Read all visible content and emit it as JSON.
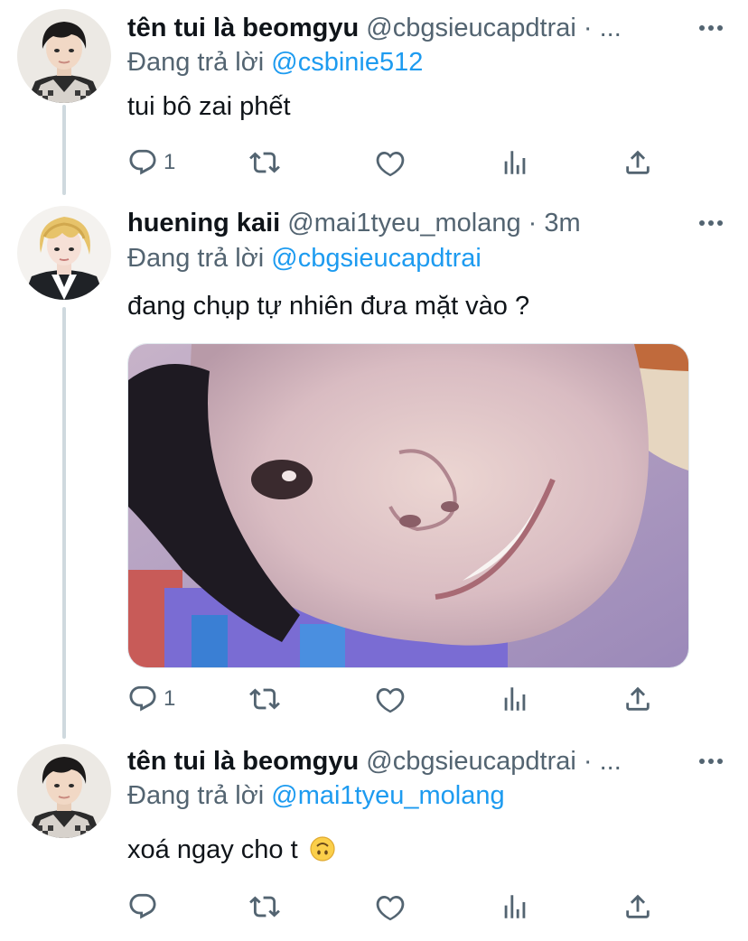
{
  "tweets": [
    {
      "display_name": "tên tui là beomgyu",
      "handle": "@cbgsieucapdtrai",
      "separator": "·",
      "time": "...",
      "replying_prefix": "Đang trả lời",
      "replying_to": "@csbinie512",
      "text": "tui bô zai phết",
      "reply_count": "1",
      "retweet_count": "",
      "like_count": ""
    },
    {
      "display_name": "huening kaii",
      "handle": "@mai1tyeu_molang",
      "separator": "·",
      "time": "3m",
      "replying_prefix": "Đang trả lời",
      "replying_to": "@cbgsieucapdtrai",
      "text": "đang chụp tự nhiên đưa mặt vào ?",
      "reply_count": "1",
      "retweet_count": "",
      "like_count": ""
    },
    {
      "display_name": "tên tui là beomgyu",
      "handle": "@cbgsieucapdtrai",
      "separator": "·",
      "time": "...",
      "replying_prefix": "Đang trả lời",
      "replying_to": "@mai1tyeu_molang",
      "text": "xoá ngay cho t",
      "emoji": "upside-down-face",
      "reply_count": "",
      "retweet_count": "",
      "like_count": ""
    }
  ],
  "icons": {
    "reply": "reply-icon",
    "retweet": "retweet-icon",
    "like": "like-icon",
    "views": "analytics-icon",
    "share": "share-icon",
    "more": "more-icon"
  },
  "colors": {
    "accent": "#1d9bf0",
    "text_primary": "#0f1419",
    "text_secondary": "#536471",
    "thread_line": "#cfd9de"
  }
}
